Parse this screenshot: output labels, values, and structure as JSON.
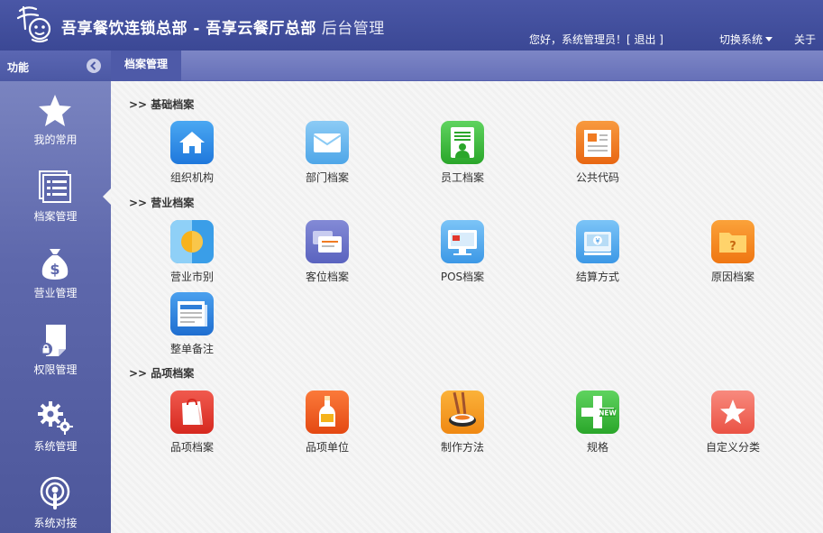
{
  "header": {
    "title_main": "吾享餐饮连锁总部 - 吾享云餐厅总部",
    "title_sub": " 后台管理",
    "greeting": "您好，系统管理员！",
    "logout_label": "[ 退出 ]",
    "switch_label": "切换系统",
    "about_label": "关于"
  },
  "function_bar": {
    "label": "功能"
  },
  "tab": {
    "label": "档案管理"
  },
  "sidebar": {
    "items": [
      {
        "label": "我的常用",
        "icon": "star-icon"
      },
      {
        "label": "档案管理",
        "icon": "document-list-icon"
      },
      {
        "label": "营业管理",
        "icon": "money-bag-icon"
      },
      {
        "label": "权限管理",
        "icon": "lock-file-icon"
      },
      {
        "label": "系统管理",
        "icon": "gears-icon"
      },
      {
        "label": "系统对接",
        "icon": "connect-icon"
      }
    ]
  },
  "sections": [
    {
      "title": ">> 基础档案",
      "items": [
        {
          "label": "组织机构",
          "icon": "home-icon",
          "color": "#2f8ee8"
        },
        {
          "label": "部门档案",
          "icon": "envelope-icon",
          "color": "#6cb8ee"
        },
        {
          "label": "员工档案",
          "icon": "employee-card-icon",
          "color": "#3cb83c"
        },
        {
          "label": "公共代码",
          "icon": "code-document-icon",
          "color": "#f07b22"
        }
      ]
    },
    {
      "title": ">> 营业档案",
      "items": [
        {
          "label": "营业市别",
          "icon": "sun-shift-icon",
          "color": "#3aa0e8"
        },
        {
          "label": "客位档案",
          "icon": "seat-cards-icon",
          "color": "#6a73c9"
        },
        {
          "label": "POS档案",
          "icon": "pos-monitor-icon",
          "color": "#4aa6ee"
        },
        {
          "label": "结算方式",
          "icon": "cash-register-icon",
          "color": "#4aa6ee"
        },
        {
          "label": "原因档案",
          "icon": "question-folder-icon",
          "color": "#f58a1f"
        },
        {
          "label": "整单备注",
          "icon": "note-document-icon",
          "color": "#2f7ed8"
        }
      ]
    },
    {
      "title": ">> 品项档案",
      "items": [
        {
          "label": "品项档案",
          "icon": "shopping-bag-icon",
          "color": "#e2382e"
        },
        {
          "label": "品项单位",
          "icon": "bottle-icon",
          "color": "#f05a1f"
        },
        {
          "label": "制作方法",
          "icon": "sushi-chopsticks-icon",
          "color": "#f59a1f"
        },
        {
          "label": "规格",
          "icon": "new-plus-icon",
          "color": "#3cb83c"
        },
        {
          "label": "自定义分类",
          "icon": "star-badge-icon",
          "color": "#f26a5a"
        }
      ]
    }
  ]
}
